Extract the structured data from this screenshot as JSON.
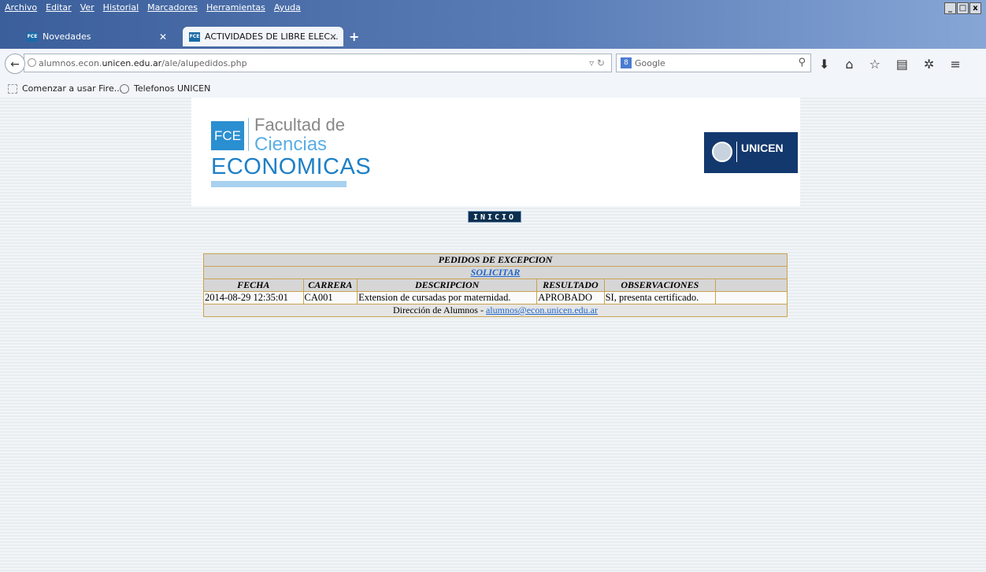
{
  "menubar": {
    "items": [
      "Archivo",
      "Editar",
      "Ver",
      "Historial",
      "Marcadores",
      "Herramientas",
      "Ayuda"
    ],
    "window_buttons": [
      "_",
      "□",
      "x"
    ]
  },
  "tabs": [
    {
      "label": "Novedades",
      "favicon": "FCE"
    },
    {
      "label": "ACTIVIDADES DE LIBRE ELEC...",
      "favicon": "FCE"
    }
  ],
  "new_tab_label": "+",
  "address": {
    "prefix": "alumnos.econ.",
    "host": "unicen.edu.ar",
    "path": "/ale/alupedidos.php"
  },
  "search": {
    "engine_badge": "8",
    "placeholder": "Google"
  },
  "bookmarks": [
    {
      "label": "Comenzar a usar Fire..."
    },
    {
      "label": "Telefonos UNICEN"
    }
  ],
  "header": {
    "logo_block": "FCE",
    "logo_line1": "Facultad de",
    "logo_line2": "Ciencias",
    "logo_line3": "ECONOMICAS",
    "unicen_name": "UNICEN"
  },
  "nav": {
    "inicio": "INICIO"
  },
  "pedidos": {
    "title": "PEDIDOS DE EXCEPCION",
    "solicitar": "SOLICITAR",
    "columns": [
      "FECHA",
      "CARRERA",
      "DESCRIPCION",
      "RESULTADO",
      "OBSERVACIONES"
    ],
    "rows": [
      {
        "fecha": "2014-08-29 12:35:01",
        "carrera": "CA001",
        "descripcion": "Extension de cursadas por maternidad.",
        "resultado": "APROBADO",
        "observaciones": "SI, presenta certificado."
      }
    ]
  },
  "footer": {
    "text": "Dirección de Alumnos - ",
    "email": "alumnos@econ.unicen.edu.ar"
  },
  "colors": {
    "menubar_start": "#3b5f9b",
    "accent_blue": "#1e80c6",
    "table_border": "#c7a351",
    "unicen_navy": "#12386e"
  }
}
